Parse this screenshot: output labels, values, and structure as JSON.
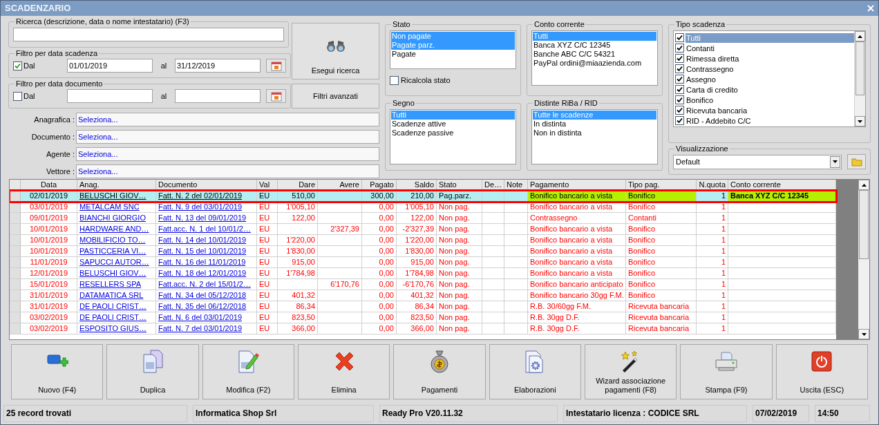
{
  "window": {
    "title": "SCADENZARIO"
  },
  "search": {
    "label": "Ricerca (descrizione, data o nome intestatario) (F3)"
  },
  "date_filter": {
    "label": "Filtro per data scadenza",
    "check_label": "Dal",
    "checked": true,
    "from": "01/01/2019",
    "to_label": "al",
    "to": "31/12/2019"
  },
  "doc_filter": {
    "label": "Filtro per data documento",
    "check_label": "Dal",
    "checked": false,
    "to_label": "al"
  },
  "search_button": "Esegui ricerca",
  "advanced_button": "Filtri avanzati",
  "lookups": [
    {
      "label": "Anagrafica :",
      "value": "Seleziona..."
    },
    {
      "label": "Documento :",
      "value": "Seleziona..."
    },
    {
      "label": "Agente :",
      "value": "Seleziona..."
    },
    {
      "label": "Vettore :",
      "value": "Seleziona..."
    }
  ],
  "stato": {
    "title": "Stato",
    "items": [
      {
        "label": "Non pagate",
        "selected": true
      },
      {
        "label": "Pagate parz.",
        "selected": true
      },
      {
        "label": "Pagate",
        "selected": false
      }
    ],
    "recalc": {
      "label": "Ricalcola stato",
      "checked": false
    }
  },
  "segno": {
    "title": "Segno",
    "items": [
      {
        "label": "Tutti",
        "selected": true
      },
      {
        "label": "Scadenze attive",
        "selected": false
      },
      {
        "label": "Scadenze passive",
        "selected": false
      }
    ]
  },
  "conto": {
    "title": "Conto corrente",
    "items": [
      {
        "label": "Tutti",
        "selected": true
      },
      {
        "label": "Banca XYZ C/C 12345",
        "selected": false
      },
      {
        "label": "Banche ABC C/C 54321",
        "selected": false
      },
      {
        "label": "PayPal ordini@miaazienda.com",
        "selected": false
      }
    ]
  },
  "distinte": {
    "title": "Distinte RiBa / RID",
    "items": [
      {
        "label": "Tutte le scadenze",
        "selected": true
      },
      {
        "label": "In distinta",
        "selected": false
      },
      {
        "label": "Non in distinta",
        "selected": false
      }
    ]
  },
  "tipo_scadenza": {
    "title": "Tipo scadenza",
    "items": [
      {
        "label": "Tutti",
        "checked": true,
        "selected": true
      },
      {
        "label": "Contanti",
        "checked": true,
        "selected": false
      },
      {
        "label": "Rimessa diretta",
        "checked": true,
        "selected": false
      },
      {
        "label": "Contrassegno",
        "checked": true,
        "selected": false
      },
      {
        "label": "Assegno",
        "checked": true,
        "selected": false
      },
      {
        "label": "Carta di credito",
        "checked": true,
        "selected": false
      },
      {
        "label": "Bonifico",
        "checked": true,
        "selected": false
      },
      {
        "label": "Ricevuta bancaria",
        "checked": true,
        "selected": false
      },
      {
        "label": "RID - Addebito C/C",
        "checked": true,
        "selected": false
      }
    ]
  },
  "visualizzazione": {
    "title": "Visualizzazione",
    "value": "Default"
  },
  "table": {
    "columns": [
      {
        "label": "Data",
        "kind": "center",
        "accent": false
      },
      {
        "label": "Anag.",
        "kind": "link",
        "accent": false
      },
      {
        "label": "Documento",
        "kind": "link",
        "accent": false
      },
      {
        "label": "Val",
        "kind": "text",
        "accent": false
      },
      {
        "label": "Dare",
        "kind": "number",
        "accent": false
      },
      {
        "label": "Avere",
        "kind": "number",
        "accent": false
      },
      {
        "label": "Pagato",
        "kind": "number",
        "accent": false
      },
      {
        "label": "Saldo",
        "kind": "number",
        "accent": false
      },
      {
        "label": "Stato",
        "kind": "text",
        "accent": false
      },
      {
        "label": "De…",
        "kind": "text",
        "accent": false
      },
      {
        "label": "Note",
        "kind": "text",
        "accent": false
      },
      {
        "label": "Pagamento",
        "kind": "text",
        "accent": true
      },
      {
        "label": "Tipo pag.",
        "kind": "text",
        "accent": true
      },
      {
        "label": "N.quota",
        "kind": "number",
        "accent": false
      },
      {
        "label": "Conto corrente",
        "kind": "bold",
        "accent": true
      }
    ],
    "rows": [
      {
        "selected": true,
        "color": "#000000",
        "cells": [
          "02/01/2019",
          "BELUSCHI GIOV…",
          "Fatt. N. 2 del 02/01/2019",
          "EU",
          "510,00",
          null,
          "300,00",
          "210,00",
          "Pag.parz.",
          null,
          null,
          "Bonifico bancario a vista",
          "Bonifico",
          "1",
          "Banca XYZ C/C 12345"
        ]
      },
      {
        "selected": false,
        "color": "#ff0000",
        "cells": [
          "03/01/2019",
          "METALCAM SNC",
          "Fatt. N. 9 del 03/01/2019",
          "EU",
          "1'005,10",
          null,
          "0,00",
          "1'005,10",
          "Non pag.",
          null,
          null,
          "Bonifico bancario a vista",
          "Bonifico",
          "1",
          null
        ]
      },
      {
        "selected": false,
        "color": "#ff0000",
        "cells": [
          "09/01/2019",
          "BIANCHI GIORGIO",
          "Fatt. N. 13 del 09/01/2019",
          "EU",
          "122,00",
          null,
          "0,00",
          "122,00",
          "Non pag.",
          null,
          null,
          "Contrassegno",
          "Contanti",
          "1",
          null
        ]
      },
      {
        "selected": false,
        "color": "#ff0000",
        "cells": [
          "10/01/2019",
          "HARDWARE AND…",
          "Fatt.acc. N. 1 del 10/01/2…",
          "EU",
          null,
          "2'327,39",
          "0,00",
          "-2'327,39",
          "Non pag.",
          null,
          null,
          "Bonifico bancario a vista",
          "Bonifico",
          "1",
          null
        ]
      },
      {
        "selected": false,
        "color": "#ff0000",
        "cells": [
          "10/01/2019",
          "MOBILIFICIO TO…",
          "Fatt. N. 14 del 10/01/2019",
          "EU",
          "1'220,00",
          null,
          "0,00",
          "1'220,00",
          "Non pag.",
          null,
          null,
          "Bonifico bancario a vista",
          "Bonifico",
          "1",
          null
        ]
      },
      {
        "selected": false,
        "color": "#ff0000",
        "cells": [
          "10/01/2019",
          "PASTICCERIA VI…",
          "Fatt. N. 15 del 10/01/2019",
          "EU",
          "1'830,00",
          null,
          "0,00",
          "1'830,00",
          "Non pag.",
          null,
          null,
          "Bonifico bancario a vista",
          "Bonifico",
          "1",
          null
        ]
      },
      {
        "selected": false,
        "color": "#ff0000",
        "cells": [
          "11/01/2019",
          "SAPUCCI AUTOR…",
          "Fatt. N. 16 del 11/01/2019",
          "EU",
          "915,00",
          null,
          "0,00",
          "915,00",
          "Non pag.",
          null,
          null,
          "Bonifico bancario a vista",
          "Bonifico",
          "1",
          null
        ]
      },
      {
        "selected": false,
        "color": "#ff0000",
        "cells": [
          "12/01/2019",
          "BELUSCHI GIOV…",
          "Fatt. N. 18 del 12/01/2019",
          "EU",
          "1'784,98",
          null,
          "0,00",
          "1'784,98",
          "Non pag.",
          null,
          null,
          "Bonifico bancario a vista",
          "Bonifico",
          "1",
          null
        ]
      },
      {
        "selected": false,
        "color": "#ff0000",
        "cells": [
          "15/01/2019",
          "RESELLERS SPA",
          "Fatt.acc. N. 2 del 15/01/2…",
          "EU",
          null,
          "6'170,76",
          "0,00",
          "-6'170,76",
          "Non pag.",
          null,
          null,
          "Bonifico bancario anticipato",
          "Bonifico",
          "1",
          null
        ]
      },
      {
        "selected": false,
        "color": "#ff0000",
        "cells": [
          "31/01/2019",
          "DATAMATICA SRL",
          "Fatt. N. 34 del 05/12/2018",
          "EU",
          "401,32",
          null,
          "0,00",
          "401,32",
          "Non pag.",
          null,
          null,
          "Bonifico bancario 30gg F.M.",
          "Bonifico",
          "1",
          null
        ]
      },
      {
        "selected": false,
        "color": "#ff0000",
        "cells": [
          "31/01/2019",
          "DE PAOLI CRIST…",
          "Fatt. N. 35 del 06/12/2018",
          "EU",
          "86,34",
          null,
          "0,00",
          "86,34",
          "Non pag.",
          null,
          null,
          "R.B. 30/60gg F.M.",
          "Ricevuta bancaria",
          "1",
          null
        ]
      },
      {
        "selected": false,
        "color": "#ff0000",
        "cells": [
          "03/02/2019",
          "DE PAOLI CRIST…",
          "Fatt. N. 6 del 03/01/2019",
          "EU",
          "823,50",
          null,
          "0,00",
          "823,50",
          "Non pag.",
          null,
          null,
          "R.B. 30gg D.F.",
          "Ricevuta bancaria",
          "1",
          null
        ]
      },
      {
        "selected": false,
        "color": "#ff0000",
        "cells": [
          "03/02/2019",
          "ESPOSITO GIUS…",
          "Fatt. N. 7 del 03/01/2019",
          "EU",
          "366,00",
          null,
          "0,00",
          "366,00",
          "Non pag.",
          null,
          null,
          "R.B. 30gg D.F.",
          "Ricevuta bancaria",
          "1",
          null
        ]
      }
    ]
  },
  "actions": [
    "Nuovo (F4)",
    "Duplica",
    "Modifica (F2)",
    "Elimina",
    "Pagamenti",
    "Elaborazioni",
    "Wizard associazione pagamenti (F8)",
    "Stampa (F9)",
    "Uscita (ESC)"
  ],
  "status_bar": [
    "25 record trovati",
    "Informatica Shop Srl",
    "Ready Pro V20.11.32",
    "Intestatario licenza : CODICE SRL",
    "07/02/2019",
    "14:50"
  ]
}
